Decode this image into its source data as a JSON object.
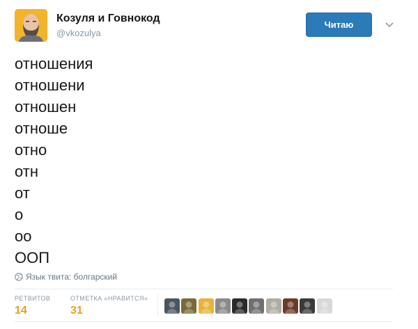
{
  "author": {
    "name": "Козуля и Говнокод",
    "handle": "@vkozulya",
    "avatar_icon": "bearded-man-avatar-icon"
  },
  "follow_button": {
    "label": "Читаю"
  },
  "menu_icon": "chevron-down-icon",
  "tweet": {
    "lines": [
      "отношения",
      "отношени",
      "отношен",
      "отноше",
      "отно",
      "отн",
      "от",
      "о",
      "оо",
      "ООП"
    ]
  },
  "language": {
    "icon": "globe-icon",
    "text": "Язык твита: болгарский"
  },
  "stats": {
    "retweets": {
      "label": "РЕТВИТОВ",
      "value": "14"
    },
    "likes": {
      "label": "ОТМЕТКА «НРАВИТСЯ»",
      "value": "31"
    }
  },
  "likers": [
    {
      "icon": "liker-avatar-icon",
      "color": "#4a5560"
    },
    {
      "icon": "liker-avatar-icon",
      "color": "#7a6a3a"
    },
    {
      "icon": "liker-avatar-icon",
      "color": "#e7b33a"
    },
    {
      "icon": "liker-avatar-icon",
      "color": "#8a8a8a"
    },
    {
      "icon": "liker-avatar-icon",
      "color": "#2a2a2a"
    },
    {
      "icon": "liker-avatar-icon",
      "color": "#6f6f6f"
    },
    {
      "icon": "liker-avatar-icon",
      "color": "#b0aca4"
    },
    {
      "icon": "liker-avatar-icon",
      "color": "#6b3b2a"
    },
    {
      "icon": "liker-avatar-icon",
      "color": "#3a3a3a"
    },
    {
      "icon": "liker-avatar-icon",
      "color": "#d8d8d8"
    }
  ],
  "colors": {
    "follow_bg": "#2b7bb9",
    "stat_value": "#e5a21a",
    "muted": "#8899a6"
  }
}
